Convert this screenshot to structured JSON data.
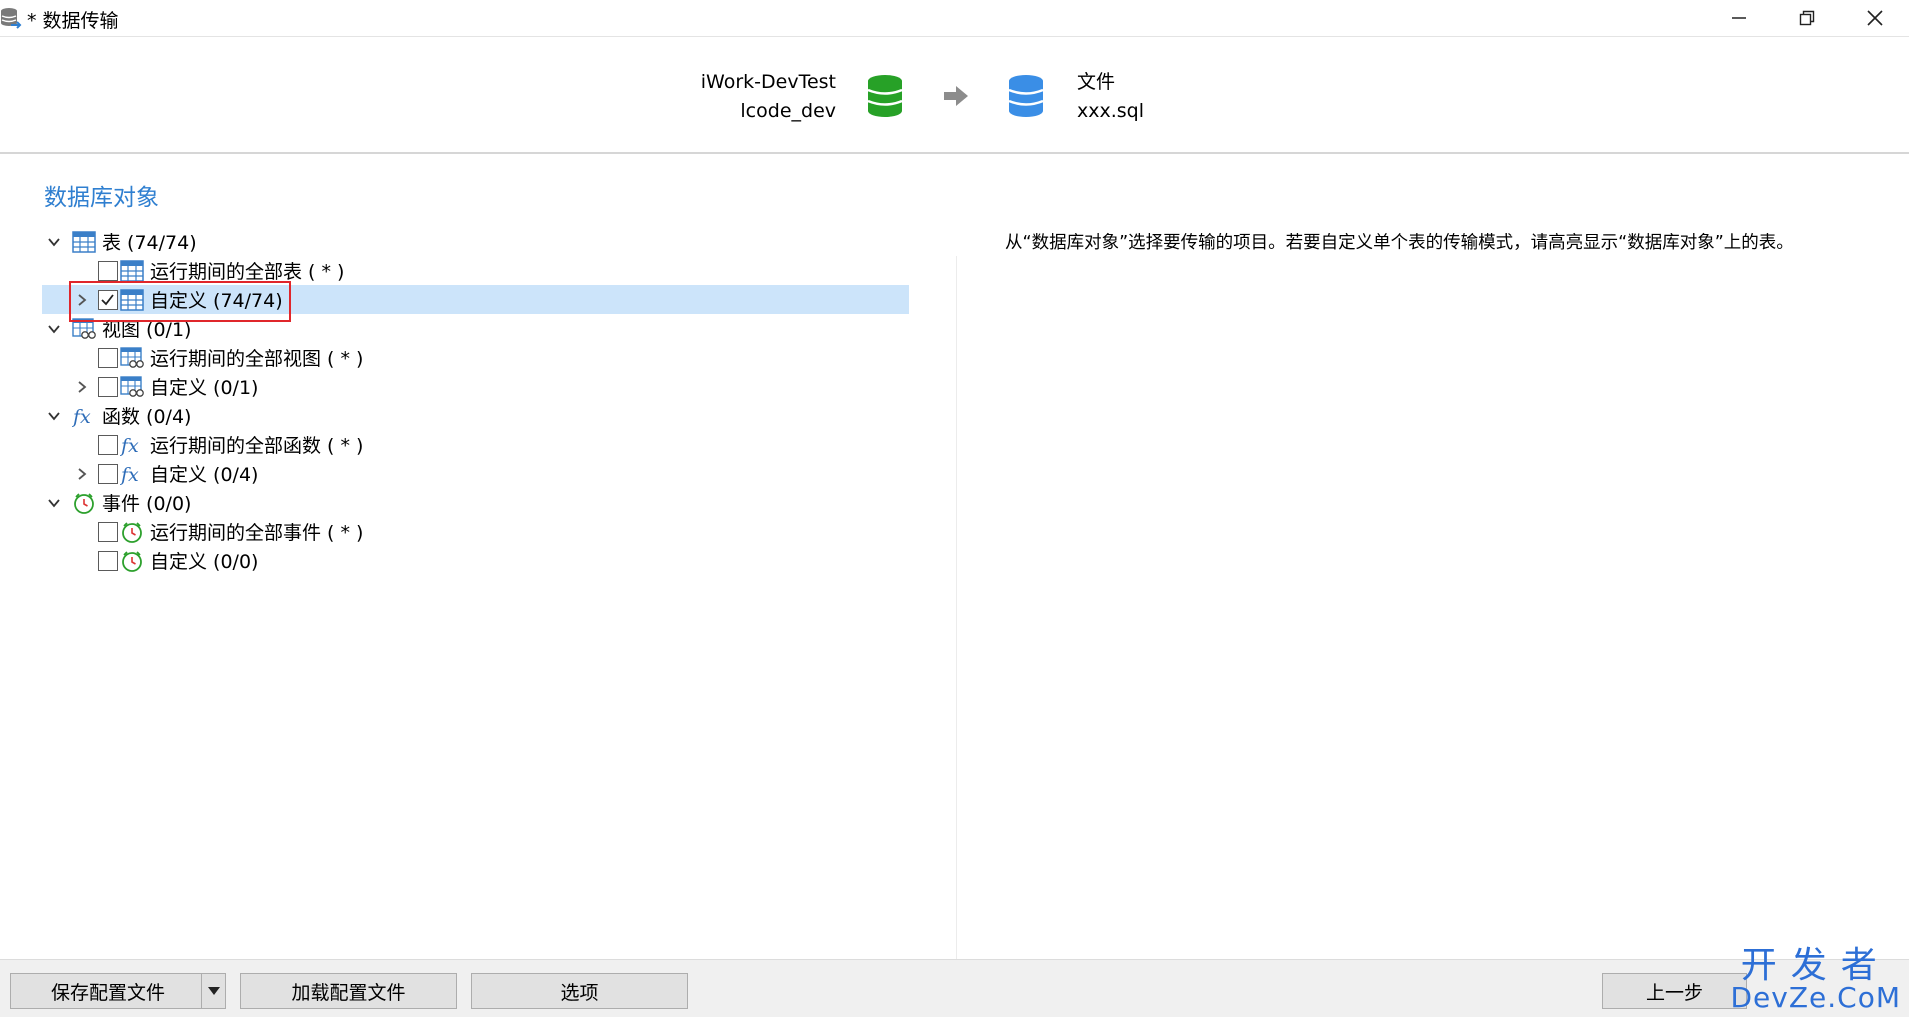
{
  "window": {
    "title": "* 数据传输",
    "minimize_icon": "minimize-icon",
    "maximize_icon": "restore-icon",
    "close_icon": "close-icon"
  },
  "header": {
    "source_connection": "iWork-DevTest",
    "source_database": "lcode_dev",
    "target_type": "文件",
    "target_file": "xxx.sql",
    "source_icon_color": "#2ca02c",
    "target_icon_color": "#3a8ee6"
  },
  "section_title": "数据库对象",
  "tree": [
    {
      "label": "表 (74/74)"
    },
    {
      "label": "运行期间的全部表 ( * )"
    },
    {
      "label": "自定义 (74/74)"
    },
    {
      "label": "视图 (0/1)"
    },
    {
      "label": "运行期间的全部视图 ( * )"
    },
    {
      "label": "自定义 (0/1)"
    },
    {
      "label": "函数 (0/4)"
    },
    {
      "label": "运行期间的全部函数 ( * )"
    },
    {
      "label": "自定义 (0/4)"
    },
    {
      "label": "事件 (0/0)"
    },
    {
      "label": "运行期间的全部事件 ( * )"
    },
    {
      "label": "自定义 (0/0)"
    }
  ],
  "hint_text": "从“数据库对象”选择要传输的项目。若要自定义单个表的传输模式，请高亮显示“数据库对象”上的表。",
  "buttons": {
    "save_profile": "保存配置文件",
    "load_profile": "加载配置文件",
    "options": "选项",
    "back": "上一步"
  },
  "watermark": {
    "line1": "开发者",
    "line2": "DevZe.CoM"
  },
  "colors": {
    "accent": "#2f7fd0",
    "selection": "#cce4fa",
    "highlight_box": "#e0262b"
  }
}
